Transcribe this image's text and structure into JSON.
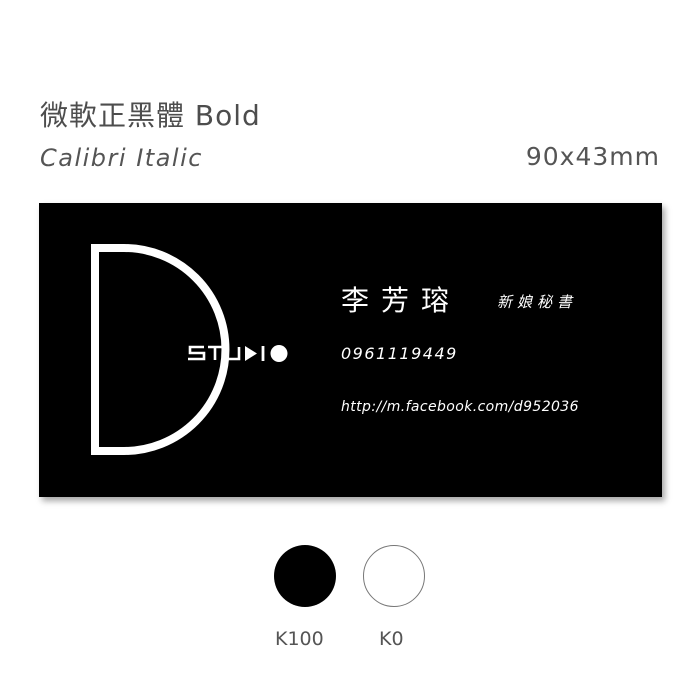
{
  "header": {
    "font_primary": "微軟正黑體 Bold",
    "font_secondary": "Calibri Italic",
    "card_size": "90x43mm"
  },
  "card": {
    "logo_text": "STUDIO",
    "name": "李芳瑢",
    "title": "新娘秘書",
    "phone": "0961119449",
    "url": "http://m.facebook.com/d952036"
  },
  "swatches": [
    {
      "label": "K100",
      "color": "#000000"
    },
    {
      "label": "K0",
      "color": "#ffffff"
    }
  ]
}
